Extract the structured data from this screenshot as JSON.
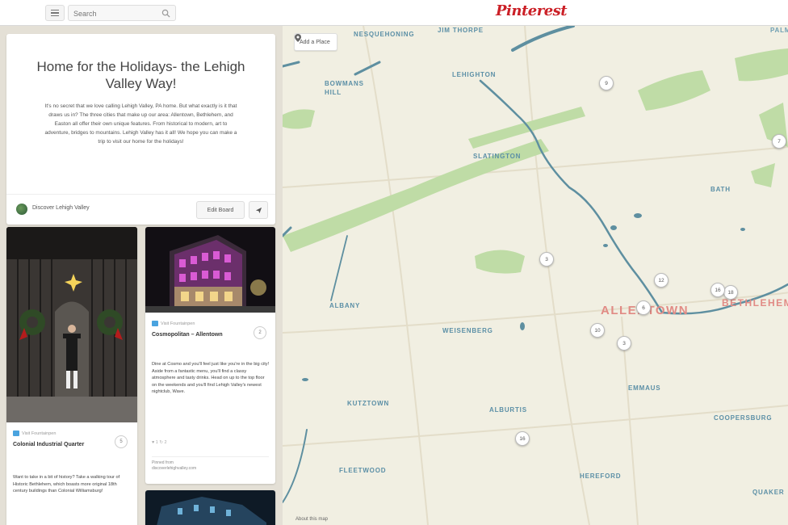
{
  "header": {
    "search_placeholder": "Search",
    "logo_text": "Pinterest"
  },
  "board": {
    "title": "Home for the Holidays- the Lehigh Valley Way!",
    "description": "It's no secret that we love calling Lehigh Valley, PA home. But what exactly is it that draws us in? The three cities that make up our area: Allentown, Bethlehem, and Easton all offer their own unique features. From historical to modern, art to adventure, bridges to mountains. Lehigh Valley has it all! We hope you can make a trip to visit our home for the holidays!",
    "owner": "Discover Lehigh Valley",
    "edit_label": "Edit Board"
  },
  "pins": [
    {
      "source": "Visit Fountainpen",
      "title": "Colonial Industrial Quarter",
      "count": "5",
      "description": "Want to take in a bit of history? Take a walking tour of Historic Bethlehem, which boasts more original 18th century buildings than Colonial Williamsburg!"
    },
    {
      "source": "Visit Fountainpen",
      "title": "Cosmopolitan – Allentown",
      "count": "2",
      "description": "Dine at Cosmo and you'll feel just like you're in the big city! Aside from a fantastic menu, you'll find a classy atmosphere and tasty drinks. Head on up to the top floor on the weekends and you'll find Lehigh Valley's newest nightclub, Wave.",
      "stats": "♥ 1   ↻ 2",
      "found_label": "Pinned from",
      "found_site": "discoverlehighvalley.com"
    }
  ],
  "map": {
    "add_place_label": "Add a Place",
    "about_label": "About this map",
    "places": [
      "NESQUEHONING",
      "JIM THORPE",
      "LEHIGHTON",
      "SLATINGTON",
      "BATH",
      "ALBANY",
      "WEISENBERG",
      "KUTZTOWN",
      "ALBURTIS",
      "EMMAUS",
      "COOPERSBURG",
      "FLEETWOOD",
      "HEREFORD",
      "QUAKER",
      "PALMERTON",
      "BOWMANS HILL"
    ],
    "cities": [
      "ALLENTOWN",
      "BETHLEHEM"
    ],
    "markers": [
      "9",
      "7",
      "3",
      "12",
      "6",
      "10",
      "18",
      "16",
      "3",
      "16"
    ]
  },
  "colors": {
    "brand": "#cb2027",
    "water": "#5e8fa0",
    "parks": "#b9d9a0",
    "map_bg": "#f1efe2"
  }
}
